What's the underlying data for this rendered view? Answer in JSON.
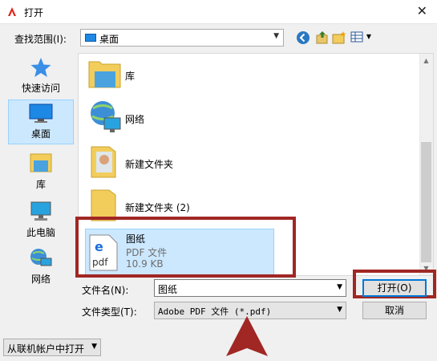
{
  "window": {
    "title": "打开",
    "close_glyph": "✕"
  },
  "lookin": {
    "label": "查找范围(I):",
    "value": "桌面"
  },
  "places": [
    {
      "label": "快速访问",
      "icon": "star-icon"
    },
    {
      "label": "桌面",
      "icon": "desktop-icon",
      "selected": true
    },
    {
      "label": "库",
      "icon": "library-icon"
    },
    {
      "label": "此电脑",
      "icon": "computer-icon"
    },
    {
      "label": "网络",
      "icon": "network-icon"
    }
  ],
  "files": [
    {
      "name": "库",
      "icon": "library-icon"
    },
    {
      "name": "网络",
      "icon": "network-icon"
    },
    {
      "name": "新建文件夹",
      "icon": "folder-icon"
    },
    {
      "name": "新建文件夹 (2)",
      "icon": "folder-icon"
    },
    {
      "name": "图纸",
      "type": "PDF 文件",
      "size": "10.9 KB",
      "icon": "pdf-icon",
      "selected": true
    }
  ],
  "filename": {
    "label": "文件名(N):",
    "value": "图纸"
  },
  "filetype": {
    "label": "文件类型(T):",
    "value": "Adobe PDF 文件 (*.pdf)"
  },
  "buttons": {
    "open": "打开(O)",
    "cancel": "取消"
  },
  "online": {
    "label": "从联机帐户中打开"
  },
  "colors": {
    "highlight": "#a02724",
    "selection": "#cce8ff",
    "accent": "#0078d7"
  }
}
